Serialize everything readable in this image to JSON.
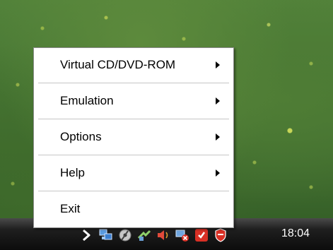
{
  "menu": {
    "items": [
      {
        "label": "Virtual CD/DVD-ROM",
        "has_submenu": true
      },
      {
        "label": "Emulation",
        "has_submenu": true
      },
      {
        "label": "Options",
        "has_submenu": true
      },
      {
        "label": "Help",
        "has_submenu": true
      },
      {
        "label": "Exit",
        "has_submenu": false
      }
    ]
  },
  "taskbar": {
    "clock": "18:04",
    "tray_icons": [
      "show-hidden-icons-chevron",
      "network-icon",
      "daemon-tools-icon",
      "connection-icon",
      "volume-icon",
      "network-error-icon",
      "update-icon",
      "security-shield-icon"
    ]
  },
  "colors": {
    "menu_background": "#ffffff",
    "menu_border": "#8c8c8c",
    "separator": "#c6c6c6",
    "taskbar": "#0c0c0c",
    "clock_text": "#ffffff"
  }
}
